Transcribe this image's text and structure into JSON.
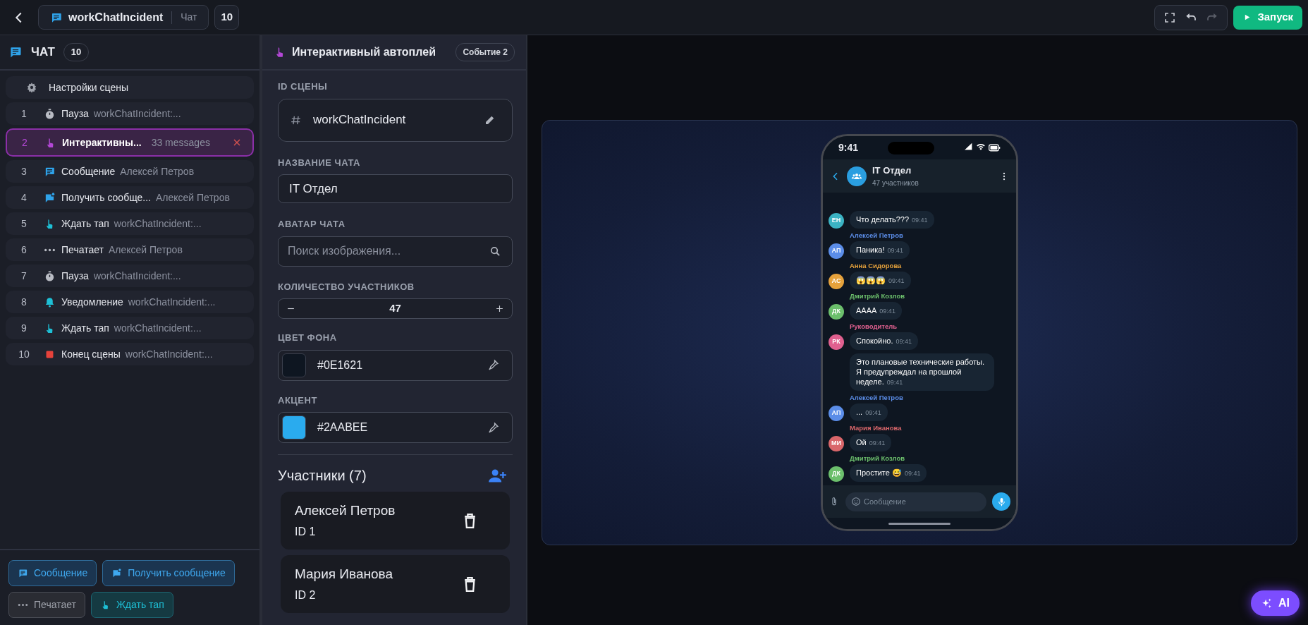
{
  "toolbar": {
    "scene_title": "workChatIncident",
    "scene_type": "Чат",
    "count": "10",
    "tools": [
      {
        "kind": "fullscreen",
        "disabled": false
      },
      {
        "kind": "undo",
        "disabled": false
      },
      {
        "kind": "redo",
        "disabled": true
      }
    ],
    "run_label": "Запуск"
  },
  "sidebar": {
    "title": "ЧАТ",
    "count": "10",
    "settings_label": "Настройки сцены",
    "events": [
      {
        "number": "1",
        "kind": "pause",
        "label": "Пауза",
        "detail": "workChatIncident:...",
        "selected": false
      },
      {
        "number": "2",
        "kind": "interactive",
        "label": "Интерактивны...",
        "detail": "33 messages",
        "selected": true
      },
      {
        "number": "3",
        "kind": "message",
        "label": "Сообщение",
        "detail": "Алексей Петров",
        "selected": false
      },
      {
        "number": "4",
        "kind": "receive",
        "label": "Получить сообще...",
        "detail": "Алексей Петров",
        "selected": false
      },
      {
        "number": "5",
        "kind": "tap",
        "label": "Ждать тап",
        "detail": "workChatIncident:...",
        "selected": false
      },
      {
        "number": "6",
        "kind": "typing",
        "label": "Печатает",
        "detail": "Алексей Петров",
        "selected": false
      },
      {
        "number": "7",
        "kind": "pause",
        "label": "Пауза",
        "detail": "workChatIncident:...",
        "selected": false
      },
      {
        "number": "8",
        "kind": "notification",
        "label": "Уведомление",
        "detail": "workChatIncident:...",
        "selected": false
      },
      {
        "number": "9",
        "kind": "tap",
        "label": "Ждать тап",
        "detail": "workChatIncident:...",
        "selected": false
      },
      {
        "number": "10",
        "kind": "end",
        "label": "Конец сцены",
        "detail": "workChatIncident:...",
        "selected": false
      }
    ],
    "add_buttons": [
      {
        "kind": "message",
        "label": "Сообщение"
      },
      {
        "kind": "receive",
        "label": "Получить сообщение"
      },
      {
        "kind": "typing",
        "label": "Печатает"
      },
      {
        "kind": "tap",
        "label": "Ждать тап"
      }
    ]
  },
  "editor": {
    "title": "Интерактивный автоплей",
    "badge": "Событие 2",
    "scene_id_label": "ID СЦЕНЫ",
    "scene_id": "workChatIncident",
    "chat_name_label": "НАЗВАНИЕ ЧАТА",
    "chat_name": "IT Отдел",
    "avatar_label": "АВАТАР ЧАТА",
    "avatar_placeholder": "Поиск изображения...",
    "members_label": "КОЛИЧЕСТВО УЧАСТНИКОВ",
    "members_count": "47",
    "background_label": "ЦВЕТ ФОНА",
    "background_value": "#0E1621",
    "accent_label": "АКЦЕНТ",
    "accent_value": "#2AABEE",
    "participants_title": "Участники (7)",
    "participants": [
      {
        "name": "Алексей Петров",
        "id": "ID 1"
      },
      {
        "name": "Мария Иванова",
        "id": "ID 2"
      }
    ]
  },
  "preview": {
    "status_time": "9:41",
    "chat_title": "IT Отдел",
    "chat_subtitle": "47 участников",
    "input_placeholder": "Сообщение",
    "groups": [
      {
        "initials": "ЕН",
        "color": "#3bb3c3",
        "messages": [
          {
            "text": "Что делать???",
            "time": "09:41"
          }
        ]
      },
      {
        "sender": "Алексей Петров",
        "initials": "АП",
        "color": "#5b8de8",
        "messages": [
          {
            "text": "Паника!",
            "time": "09:41"
          }
        ]
      },
      {
        "sender": "Анна Сидорова",
        "initials": "АС",
        "color": "#e6a23c",
        "messages": [
          {
            "text": "😱😱😱",
            "time": "09:41"
          }
        ]
      },
      {
        "sender": "Дмитрий Козлов",
        "initials": "ДК",
        "color": "#6cbf6c",
        "messages": [
          {
            "text": "АААА",
            "time": "09:41"
          }
        ]
      },
      {
        "sender": "Руководитель",
        "initials": "РК",
        "color": "#e0608f",
        "messages": [
          {
            "text": "Спокойно.",
            "time": "09:41"
          },
          {
            "text": "Это плановые технические работы. Я предупреждал на прошлой неделе.",
            "time": "09:41"
          }
        ]
      },
      {
        "sender": "Алексей Петров",
        "initials": "АП",
        "color": "#5b8de8",
        "messages": [
          {
            "text": "...",
            "time": "09:41"
          }
        ]
      },
      {
        "sender": "Мария Иванова",
        "initials": "МИ",
        "color": "#d9666a",
        "messages": [
          {
            "text": "Ой",
            "time": "09:41"
          }
        ]
      },
      {
        "sender": "Дмитрий Козлов",
        "initials": "ДК",
        "color": "#6cbf6c",
        "messages": [
          {
            "text": "Простите 😅",
            "time": "09:41"
          }
        ]
      }
    ]
  },
  "ai_label": "AI"
}
